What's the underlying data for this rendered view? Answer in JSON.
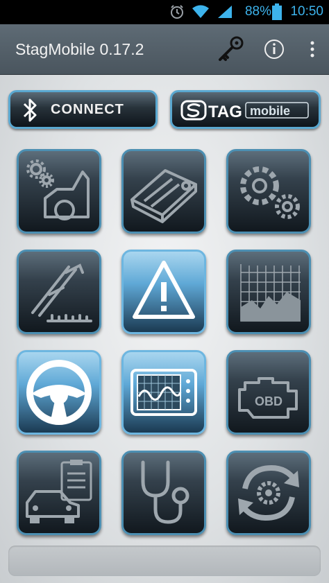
{
  "status_bar": {
    "battery": "88%",
    "time": "10:50",
    "icons": [
      "alarm-icon",
      "wifi-icon",
      "signal-icon",
      "battery-icon"
    ],
    "color": "#3db3ec"
  },
  "app_bar": {
    "title": "StagMobile 0.17.2",
    "actions": [
      "key-icon",
      "info-icon",
      "overflow-menu-icon"
    ]
  },
  "top_buttons": {
    "connect_label": "CONNECT",
    "brand_logo": "STAG mobile",
    "brand_logo_icon": "stag-mobile-logo"
  },
  "grid": {
    "tiles": [
      {
        "icon": "car-engine-settings-icon",
        "active": false
      },
      {
        "icon": "injector-rail-icon",
        "active": false
      },
      {
        "icon": "gears-icon",
        "active": false
      },
      {
        "icon": "caliper-icon",
        "active": false
      },
      {
        "icon": "warning-icon",
        "active": true
      },
      {
        "icon": "area-chart-icon",
        "active": false
      },
      {
        "icon": "steering-wheel-icon",
        "active": true
      },
      {
        "icon": "oscilloscope-icon",
        "active": true
      },
      {
        "icon": "obd-engine-icon",
        "active": false
      },
      {
        "icon": "car-clipboard-icon",
        "active": false
      },
      {
        "icon": "stethoscope-icon",
        "active": false
      },
      {
        "icon": "update-sync-icon",
        "active": false
      }
    ]
  },
  "colors": {
    "accent": "#4c8fb2",
    "app_bar": "#56626c",
    "active_tile": "#5fa8d6"
  }
}
